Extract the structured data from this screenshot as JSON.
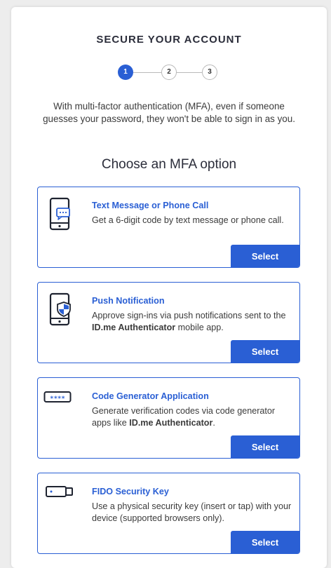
{
  "header": {
    "title": "SECURE YOUR ACCOUNT"
  },
  "stepper": {
    "steps": [
      "1",
      "2",
      "3"
    ],
    "active_step": 1
  },
  "intro": "With multi-factor authentication (MFA), even if someone guesses your password, they won't be able to sign in as you.",
  "subtitle": "Choose an MFA option",
  "options": [
    {
      "title": "Text Message or Phone Call",
      "description": "Get a 6-digit code by text message or phone call.",
      "description_pre": "Get a 6-digit code by text message or phone call.",
      "description_bold": "",
      "description_post": "",
      "icon": "phone-chat-icon",
      "button": "Select"
    },
    {
      "title": "Push Notification",
      "description": "Approve sign-ins via push notifications sent to the ID.me Authenticator mobile app.",
      "description_pre": "Approve sign-ins via push notifications sent to the ",
      "description_bold": "ID.me Authenticator",
      "description_post": " mobile app.",
      "icon": "phone-shield-icon",
      "button": "Select"
    },
    {
      "title": "Code Generator Application",
      "description": "Generate verification codes via code generator apps like ID.me Authenticator.",
      "description_pre": "Generate verification codes via code generator apps like ",
      "description_bold": "ID.me Authenticator",
      "description_post": ".",
      "icon": "code-asterisks-icon",
      "icon_text": "****",
      "button": "Select"
    },
    {
      "title": "FIDO Security Key",
      "description": "Use a physical security key (insert or tap) with your device (supported browsers only).",
      "description_pre": "Use a physical security key (insert or tap) with your device (supported browsers only).",
      "description_bold": "",
      "description_post": "",
      "icon": "security-key-icon",
      "button": "Select"
    }
  ],
  "colors": {
    "accent": "#2a5fd4",
    "text": "#3b3b3b",
    "heading": "#2b2d3a",
    "background": "#ededed",
    "card": "#ffffff",
    "step_inactive_border": "#b9b9b9"
  }
}
